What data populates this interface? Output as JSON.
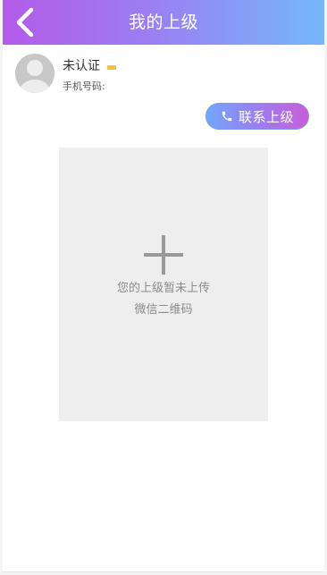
{
  "header": {
    "title": "我的上级",
    "back_icon": "chevron-left-icon"
  },
  "profile": {
    "avatar_icon": "default-avatar-icon",
    "name": "未认证",
    "status_badge_color": "#f0c43a",
    "phone_label": "手机号码:"
  },
  "contact_button": {
    "label": "联系上级",
    "icon": "phone-icon"
  },
  "qrcode": {
    "icon": "plus-icon",
    "line1": "您的上级暂未上传",
    "line2": "微信二维码"
  },
  "colors": {
    "header_gradient_start": "#b45ae8",
    "header_gradient_end": "#74b8fb",
    "button_gradient_start": "#71a7f8",
    "button_gradient_end": "#c85ed8",
    "placeholder_bg": "#eeeeee"
  }
}
